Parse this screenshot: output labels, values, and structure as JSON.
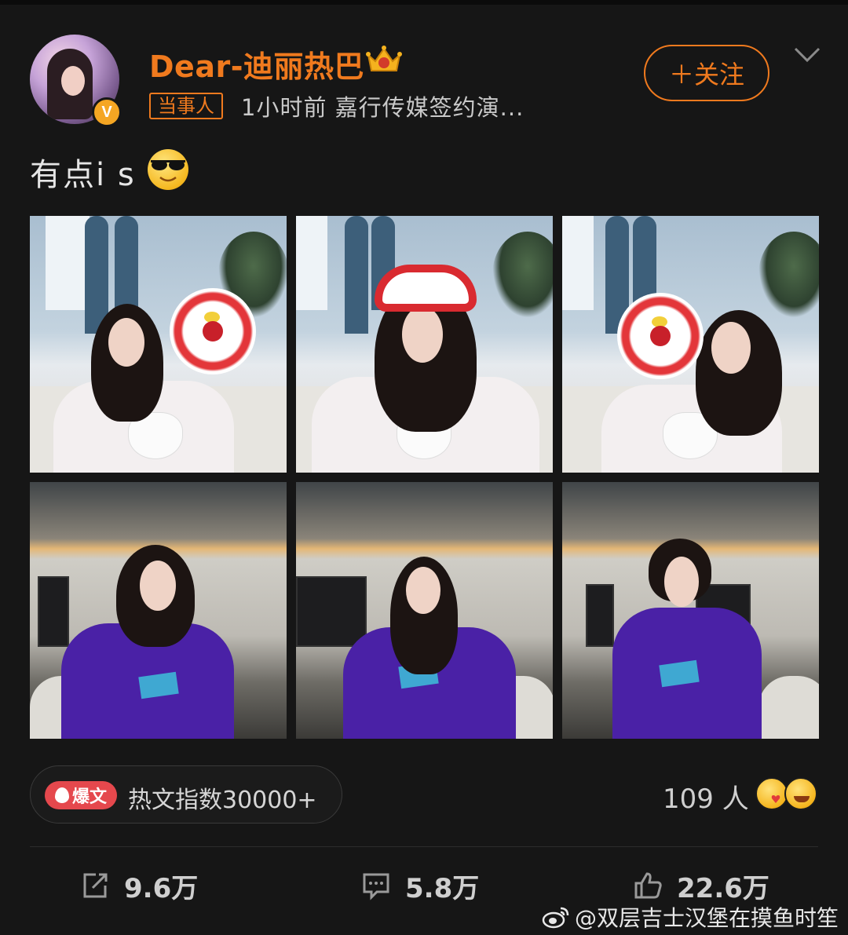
{
  "post": {
    "username": "Dear-迪丽热巴",
    "verified_badge": "V",
    "tag": "当事人",
    "meta": "1小时前   嘉行传媒签约演...",
    "follow_label": "＋关注",
    "text": "有点i s",
    "text_emoji": "sunglasses-emoji",
    "photos": [
      {
        "name": "photo-1"
      },
      {
        "name": "photo-2"
      },
      {
        "name": "photo-3"
      },
      {
        "name": "photo-4"
      },
      {
        "name": "photo-5"
      },
      {
        "name": "photo-6"
      }
    ]
  },
  "hot": {
    "badge_label": "爆文",
    "text": "热文指数30000+"
  },
  "reactions": {
    "count_text": "109 人"
  },
  "actions": {
    "repost": "9.6万",
    "comment": "5.8万",
    "like": "22.6万"
  },
  "watermark": {
    "text": "@双层吉士汉堡在摸鱼时笙"
  },
  "colors": {
    "accent": "#f07a1e",
    "background": "#161616",
    "hot_badge": "#e5484d"
  }
}
